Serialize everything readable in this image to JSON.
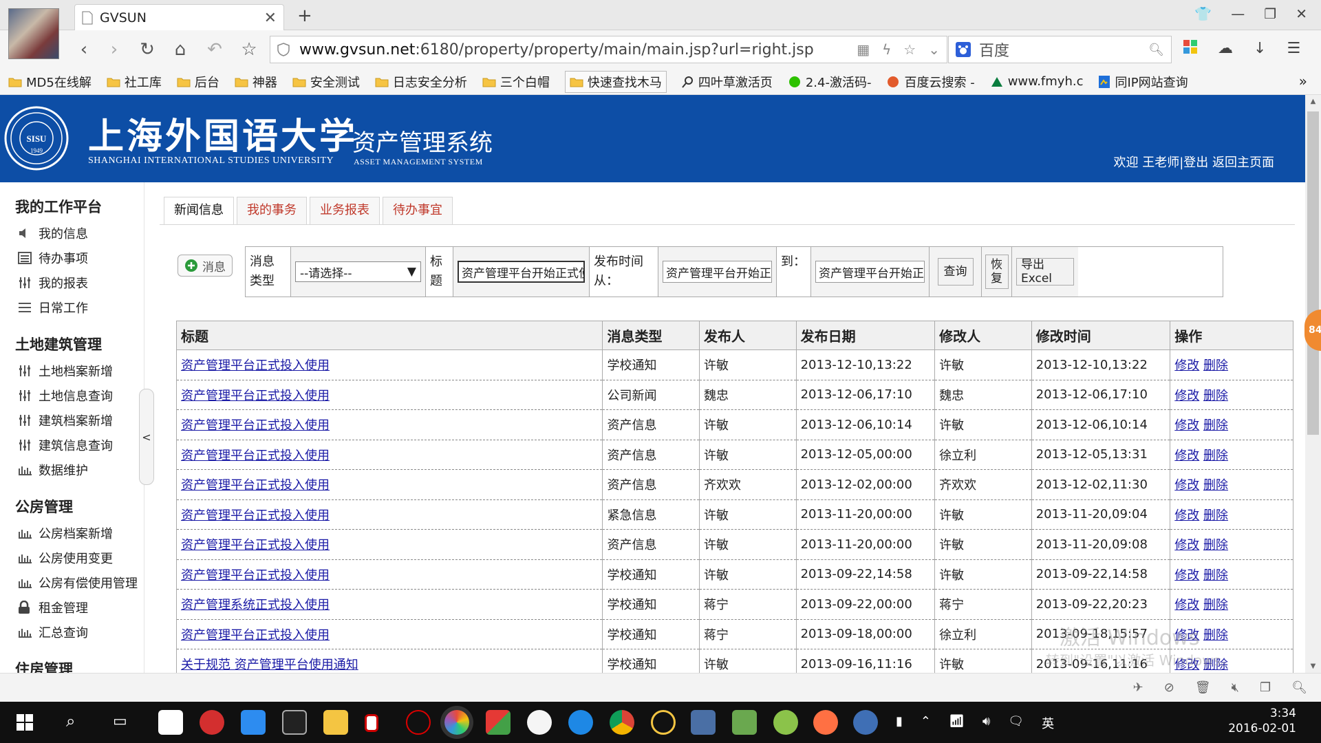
{
  "browser": {
    "tab_title": "GVSUN",
    "url_host": "www.gvsun.net",
    "url_rest": ":6180/property/property/main/main.jsp?url=right.jsp",
    "search_engine": "百度",
    "bookmarks": [
      {
        "label": "MD5在线解",
        "icon": "folder"
      },
      {
        "label": "社工库",
        "icon": "folder"
      },
      {
        "label": "后台",
        "icon": "folder"
      },
      {
        "label": "神器",
        "icon": "folder"
      },
      {
        "label": "安全测试",
        "icon": "folder"
      },
      {
        "label": "日志安全分析",
        "icon": "folder"
      },
      {
        "label": "三个白帽",
        "icon": "folder"
      },
      {
        "label": "快速查找木马",
        "icon": "folder"
      },
      {
        "label": "四叶草激活页",
        "icon": "search"
      },
      {
        "label": "2.4-激活码-",
        "icon": "wechat"
      },
      {
        "label": "百度云搜索 -",
        "icon": "cloud"
      },
      {
        "label": "www.fmyh.c",
        "icon": "site"
      },
      {
        "label": "同IP网站查询",
        "icon": "page"
      }
    ],
    "more": "»"
  },
  "header": {
    "uni_cn": "上海外国语大学",
    "uni_en": "SHANGHAI INTERNATIONAL STUDIES UNIVERSITY",
    "sys_cn": "资产管理系统",
    "sys_en": "ASSET MANAGEMENT SYSTEM",
    "seal_text": "SISU",
    "seal_year": "1949",
    "welcome": "欢迎 王老师|登出 返回主页面"
  },
  "sidebar": {
    "sections": [
      {
        "title": "我的工作平台",
        "items": [
          "我的信息",
          "待办事项",
          "我的报表",
          "日常工作"
        ]
      },
      {
        "title": "土地建筑管理",
        "items": [
          "土地档案新增",
          "土地信息查询",
          "建筑档案新增",
          "建筑信息查询",
          "数据维护"
        ]
      },
      {
        "title": "公房管理",
        "items": [
          "公房档案新增",
          "公房使用变更",
          "公房有偿使用管理",
          "租金管理",
          "汇总查询"
        ]
      },
      {
        "title": "住房管理",
        "items": []
      }
    ],
    "collapse": "<"
  },
  "tabs": [
    {
      "label": "新闻信息",
      "active": true
    },
    {
      "label": "我的事务",
      "active": false
    },
    {
      "label": "业务报表",
      "active": false
    },
    {
      "label": "待办事宜",
      "active": false
    }
  ],
  "filter": {
    "msg_button": "消息",
    "type_label": "消息类型",
    "type_value": "--请选择--",
    "title_label": "标题",
    "title_value": "资产管理平台开始正式使用",
    "from_label": "发布时间从：",
    "from_value": "资产管理平台开始正式使",
    "to_label": "到：",
    "to_value": "资产管理平台开始正式使",
    "query_button": "查询",
    "reset_button": "恢复",
    "export_button": "导出Excel"
  },
  "table": {
    "columns": [
      "标题",
      "消息类型",
      "发布人",
      "发布日期",
      "修改人",
      "修改时间",
      "操作"
    ],
    "edit_label": "修改",
    "delete_label": "删除",
    "rows": [
      [
        "资产管理平台正式投入使用",
        "学校通知",
        "许敏",
        "2013-12-10,13:22",
        "许敏",
        "2013-12-10,13:22"
      ],
      [
        "资产管理平台正式投入使用",
        "公司新闻",
        "魏忠",
        "2013-12-06,17:10",
        "魏忠",
        "2013-12-06,17:10"
      ],
      [
        "资产管理平台正式投入使用",
        "资产信息",
        "许敏",
        "2013-12-06,10:14",
        "许敏",
        "2013-12-06,10:14"
      ],
      [
        "资产管理平台正式投入使用",
        "资产信息",
        "许敏",
        "2013-12-05,00:00",
        "徐立利",
        "2013-12-05,13:31"
      ],
      [
        "资产管理平台正式投入使用",
        "资产信息",
        "齐欢欢",
        "2013-12-02,00:00",
        "齐欢欢",
        "2013-12-02,11:30"
      ],
      [
        "资产管理平台正式投入使用",
        "紧急信息",
        "许敏",
        "2013-11-20,00:00",
        "许敏",
        "2013-11-20,09:04"
      ],
      [
        "资产管理平台正式投入使用",
        "资产信息",
        "许敏",
        "2013-11-20,00:00",
        "许敏",
        "2013-11-20,09:08"
      ],
      [
        "资产管理平台正式投入使用",
        "学校通知",
        "许敏",
        "2013-09-22,14:58",
        "许敏",
        "2013-09-22,14:58"
      ],
      [
        "资产管理系统正式投入使用",
        "学校通知",
        "蒋宁",
        "2013-09-22,00:00",
        "蒋宁",
        "2013-09-22,20:23"
      ],
      [
        "资产管理平台正式投入使用",
        "学校通知",
        "蒋宁",
        "2013-09-18,00:00",
        "徐立利",
        "2013-09-18,15:57"
      ],
      [
        "关于规范 资产管理平台使用通知",
        "学校通知",
        "许敏",
        "2013-09-16,11:16",
        "许敏",
        "2013-09-16,11:16"
      ]
    ]
  },
  "floating_badge": "84",
  "watermark": {
    "line1": "激活 Windows",
    "line2": "转到\"设置\"以激活 Windows。"
  },
  "taskbar": {
    "time": "3:34",
    "date": "2016-02-01",
    "ime": "英"
  },
  "colors": {
    "header_blue": "#0d4ea6",
    "tab_red": "#c0392b",
    "link_blue": "#1a1aa6"
  }
}
